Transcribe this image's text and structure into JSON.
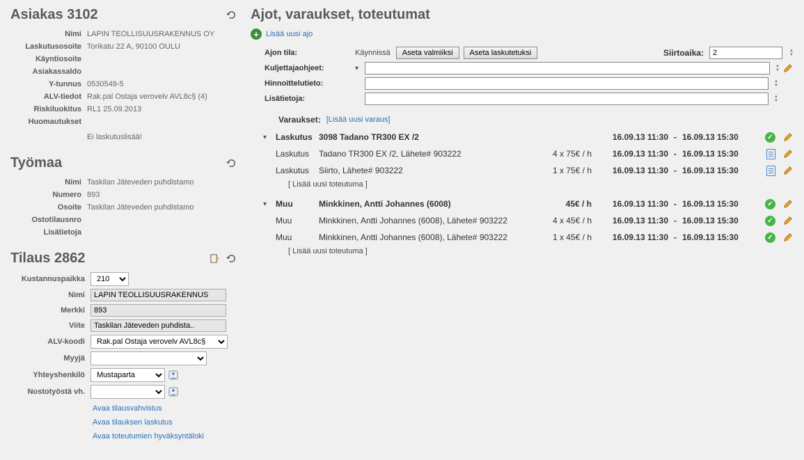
{
  "customer": {
    "title": "Asiakas 3102",
    "fields": {
      "nimi_label": "Nimi",
      "nimi": "LAPIN TEOLLISUUSRAKENNUS OY",
      "laskutus_label": "Laskutusosoite",
      "laskutus": "Torikatu 22 A, 90100 OULU",
      "kayntiosoite_label": "Käyntiosoite",
      "kayntiosoite": "",
      "asiakassaldo_label": "Asiakassaldo",
      "asiakassaldo": "",
      "ytunnus_label": "Y-tunnus",
      "ytunnus": "0530549-5",
      "alv_label": "ALV-tiedot",
      "alv": "Rak.pal Ostaja verovelv AVL8c§ (4)",
      "riski_label": "Riskiluokitus",
      "riski": "RL1 25.09.2013",
      "huom_label": "Huomautukset",
      "huom": "",
      "note": "Ei laskutuslisää!"
    }
  },
  "worksite": {
    "title": "Työmaa",
    "fields": {
      "nimi_label": "Nimi",
      "nimi": "Taskilan Jäteveden puhdistamo",
      "numero_label": "Numero",
      "numero": "893",
      "osoite_label": "Osoite",
      "osoite": "Taskilan Jäteveden puhdistamo",
      "ostotilaus_label": "Ostotilausnro",
      "ostotilaus": "",
      "lisatietoja_label": "Lisätietoja",
      "lisatietoja": ""
    }
  },
  "order": {
    "title": "Tilaus 2862",
    "kustannus_label": "Kustannuspaikka",
    "kustannus": "210",
    "nimi_label": "Nimi",
    "nimi": "LAPIN TEOLLISUUSRAKENNUS",
    "merkki_label": "Merkki",
    "merkki": "893",
    "viite_label": "Viite",
    "viite": "Taskilan Jäteveden puhdista..",
    "alvkoodi_label": "ALV-koodi",
    "alvkoodi": "Rak.pal Ostaja verovelv AVL8c§",
    "myyja_label": "Myyjä",
    "myyja": "",
    "yhteys_label": "Yhteyshenkilö",
    "yhteys": "Mustaparta",
    "nosto_label": "Nostotyöstä vh.",
    "nosto": "",
    "links": {
      "vahvistus": "Avaa tilausvahvistus",
      "laskutus": "Avaa tilauksen laskutus",
      "hyvaksynta": "Avaa toteutumien hyväksyntäloki"
    }
  },
  "drives": {
    "title": "Ajot, varaukset, toteutumat",
    "add_label": "Lisää uusi ajo",
    "ajon_tila_label": "Ajon tila:",
    "status": "Käynnissä",
    "btn_valmis": "Aseta valmiiksi",
    "btn_laskute": "Aseta laskutetuksi",
    "siirto_label": "Siirtoaika:",
    "siirto_value": "2",
    "kuljettaja_label": "Kuljettajaohjeet:",
    "hinnoittelu_label": "Hinnoittelutieto:",
    "lisatietoja_label": "Lisätietoja:",
    "varaukset_label": "Varaukset:",
    "varaukset_add": "[Lisää uusi varaus]",
    "toteutuma_add": "[ Lisää uusi toteutuma ]",
    "groups": [
      {
        "type": "Laskutus",
        "title": "3098 Tadano TR300 EX /2",
        "rate": "",
        "t1": "16.09.13 11:30",
        "t2": "16.09.13 15:30",
        "icon": "check",
        "rows": [
          {
            "type": "Laskutus",
            "desc": "Tadano TR300 EX /2, Lähete# 903222",
            "rate": "4 x 75€ / h",
            "t1": "16.09.13 11:30",
            "t2": "16.09.13 15:30",
            "icon": "doc"
          },
          {
            "type": "Laskutus",
            "desc": "Siirto, Lähete# 903222",
            "rate": "1 x 75€ / h",
            "t1": "16.09.13 11:30",
            "t2": "16.09.13 15:30",
            "icon": "doc"
          }
        ]
      },
      {
        "type": "Muu",
        "title": "Minkkinen, Antti Johannes (6008)",
        "rate": "45€ / h",
        "t1": "16.09.13 11:30",
        "t2": "16.09.13 15:30",
        "icon": "check",
        "rows": [
          {
            "type": "Muu",
            "desc": "Minkkinen, Antti Johannes (6008), Lähete# 903222",
            "rate": "4 x 45€ / h",
            "t1": "16.09.13 11:30",
            "t2": "16.09.13 15:30",
            "icon": "check"
          },
          {
            "type": "Muu",
            "desc": "Minkkinen, Antti Johannes (6008), Lähete# 903222",
            "rate": "1 x 45€ / h",
            "t1": "16.09.13 11:30",
            "t2": "16.09.13 15:30",
            "icon": "check"
          }
        ]
      }
    ]
  }
}
